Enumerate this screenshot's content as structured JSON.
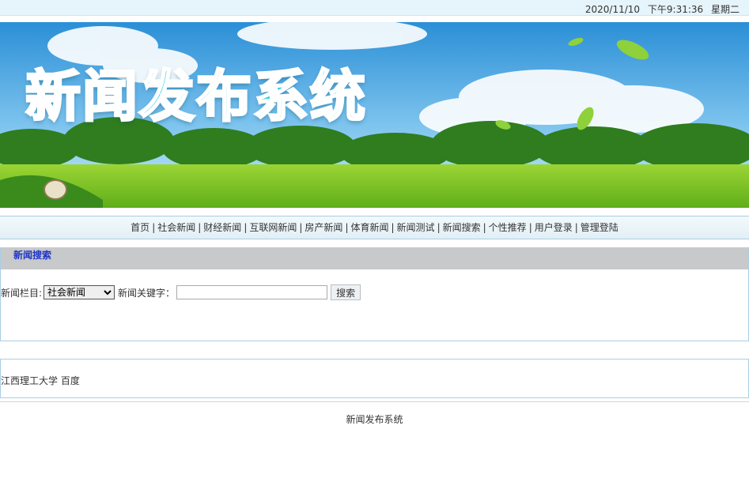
{
  "header": {
    "date": "2020/11/10",
    "time": "下午9:31:36",
    "weekday": "星期二"
  },
  "banner": {
    "title": "新闻发布系统"
  },
  "nav": {
    "items": [
      {
        "label": "首页"
      },
      {
        "label": "社会新闻"
      },
      {
        "label": "财经新闻"
      },
      {
        "label": "互联网新闻"
      },
      {
        "label": "房产新闻"
      },
      {
        "label": "体育新闻"
      },
      {
        "label": "新闻测试"
      },
      {
        "label": "新闻搜索"
      },
      {
        "label": "个性推荐"
      },
      {
        "label": "用户登录"
      },
      {
        "label": "管理登陆"
      }
    ],
    "separator": "|"
  },
  "search": {
    "panel_title": "新闻搜索",
    "category_label": "新闻栏目:",
    "category_selected": "社会新闻",
    "keyword_label": "新闻关键字：",
    "keyword_value": "",
    "button_label": "搜索"
  },
  "links": {
    "items": [
      {
        "label": "江西理工大学"
      },
      {
        "label": "百度"
      }
    ]
  },
  "footer": {
    "text": "新闻发布系统"
  },
  "colors": {
    "nav_bg": "#e2eff6",
    "panel_head_bg": "#c7c9ca",
    "panel_title": "#1e34c8",
    "banner_title": "#36d3e3",
    "border": "#a9cfe2"
  }
}
